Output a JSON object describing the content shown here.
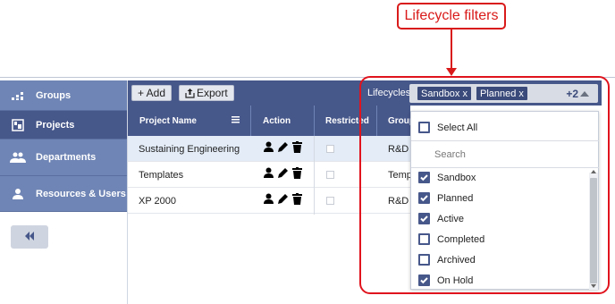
{
  "callout": {
    "text": "Lifecycle filters",
    "color": "#d91a1a"
  },
  "sidebar": {
    "items": [
      {
        "label": "Groups",
        "icon": "groups-icon"
      },
      {
        "label": "Projects",
        "icon": "projects-icon",
        "active": true
      },
      {
        "label": "Departments",
        "icon": "departments-icon"
      },
      {
        "label": "Resources & Users",
        "icon": "user-icon"
      }
    ],
    "collapse_icon": "double-chevron-left-icon"
  },
  "toolbar": {
    "add_label": "+ Add",
    "export_label": "Export",
    "lifecycles_label": "Lifecycles",
    "chips": [
      "Sandbox x",
      "Planned x"
    ],
    "more_count": "+2"
  },
  "table": {
    "columns": [
      "Project Name",
      "Action",
      "Restricted",
      "Group"
    ],
    "rows": [
      {
        "name": "Sustaining Engineering",
        "group": "R&D",
        "selected": true
      },
      {
        "name": "Templates",
        "group": "Temp",
        "selected": false
      },
      {
        "name": "XP 2000",
        "group": "R&D",
        "selected": false
      }
    ]
  },
  "dropdown": {
    "select_all": "Select All",
    "search_placeholder": "Search",
    "options": [
      {
        "label": "Sandbox",
        "checked": true
      },
      {
        "label": "Planned",
        "checked": true
      },
      {
        "label": "Active",
        "checked": true
      },
      {
        "label": "Completed",
        "checked": false
      },
      {
        "label": "Archived",
        "checked": false
      },
      {
        "label": "On Hold",
        "checked": true
      }
    ]
  },
  "colors": {
    "header": "#46578a",
    "sidebar": "#6f85b5",
    "highlight": "#e0141e"
  }
}
